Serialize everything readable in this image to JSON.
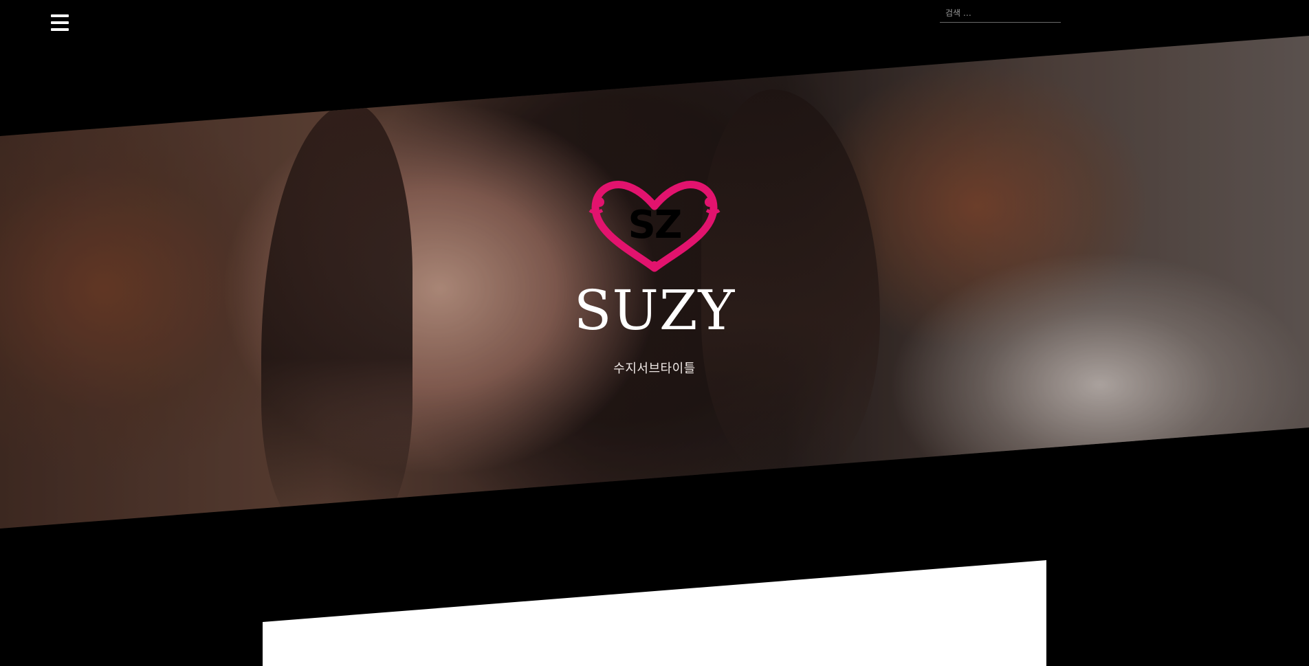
{
  "header": {
    "menu_icon": "hamburger-menu-icon",
    "search": {
      "placeholder": "검색 …",
      "value": ""
    }
  },
  "hero": {
    "logo_icon": "heart-sz-logo-icon",
    "logo_text": "SZ",
    "title": "SUZY",
    "subtitle": "수지서브타이틀"
  },
  "colors": {
    "background": "#000000",
    "logo_accent": "#e2136e",
    "title_text": "#ffffff",
    "panel": "#ffffff"
  }
}
